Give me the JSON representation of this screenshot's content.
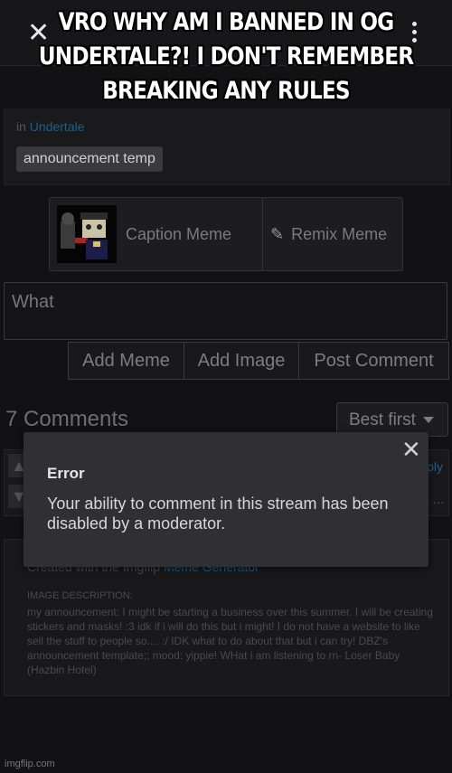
{
  "header": {
    "close_glyph": "✕"
  },
  "meme": {
    "caption": "VRO WHY AM I BANNED IN OG UNDERTALE?! I DON'T REMEMBER BREAKING ANY RULES"
  },
  "post": {
    "stream_prefix": "in",
    "stream_name": "Undertale",
    "tag": "announcement temp"
  },
  "meme_actions": {
    "caption": "Caption Meme",
    "remix": "Remix Meme"
  },
  "comment_form": {
    "input_value": "What",
    "add_meme": "Add Meme",
    "add_image": "Add Image",
    "post_comment": "Post Comment"
  },
  "comments": {
    "count_label": "7 Comments",
    "sort": "Best first",
    "reply": "Reply"
  },
  "description": {
    "credit_prefix": "Created with the Imgflip",
    "credit_link": "Meme Generator",
    "label": "IMAGE DESCRIPTION:",
    "text": "my announcement: I might be starting a business over this summer. I will be creating stickers and masks! :3 idk if i will do this but i might! I do not have a website to like sell the stuff to people so.... :/ IDK what to do about that but i can try! DBZ's announcement template;; mood: yippie! WHat i am listening to rn- Loser Baby (Hazbin Hotel)"
  },
  "dialog": {
    "title": "Error",
    "message": "Your ability to comment in this stream has been disabled by a moderator."
  },
  "watermark": "imgflip.com"
}
